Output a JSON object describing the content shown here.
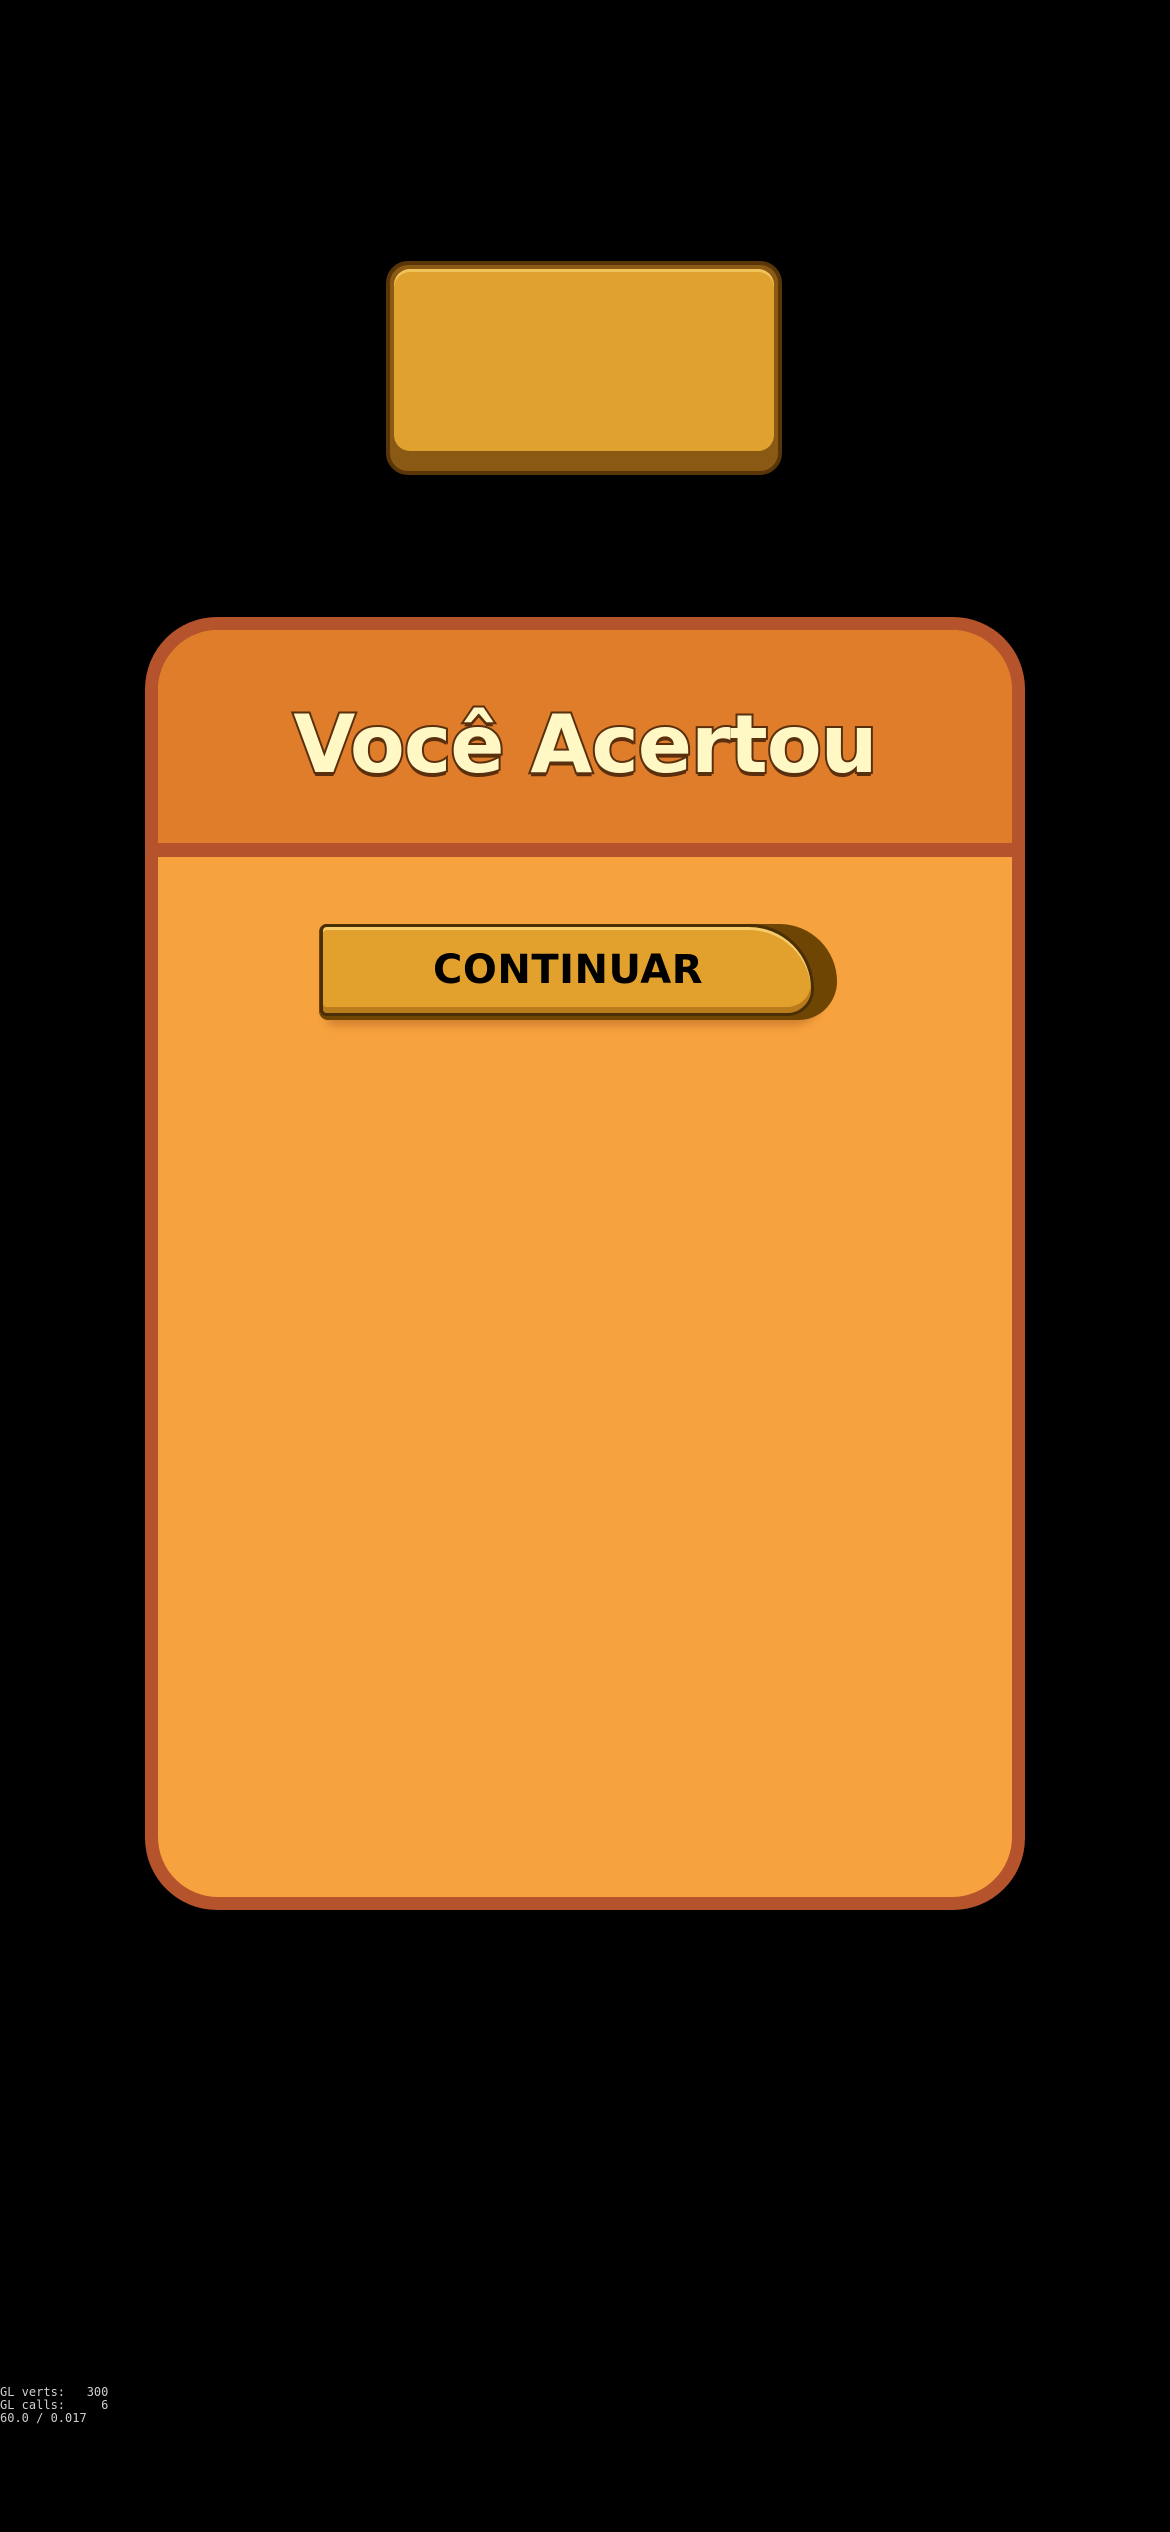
{
  "dialog": {
    "title": "Você Acertou",
    "continue_label": "CONTINUAR"
  },
  "debug": {
    "line1": "GL verts:   300",
    "line2": "GL calls:     6",
    "line3": "60.0 / 0.017"
  },
  "colors": {
    "background": "#000000",
    "panel_border": "#b5532c",
    "panel_header": "#df7d2a",
    "panel_body": "#f6a23e",
    "button_face": "#e2a12d",
    "title_fill": "#fff7c4"
  }
}
